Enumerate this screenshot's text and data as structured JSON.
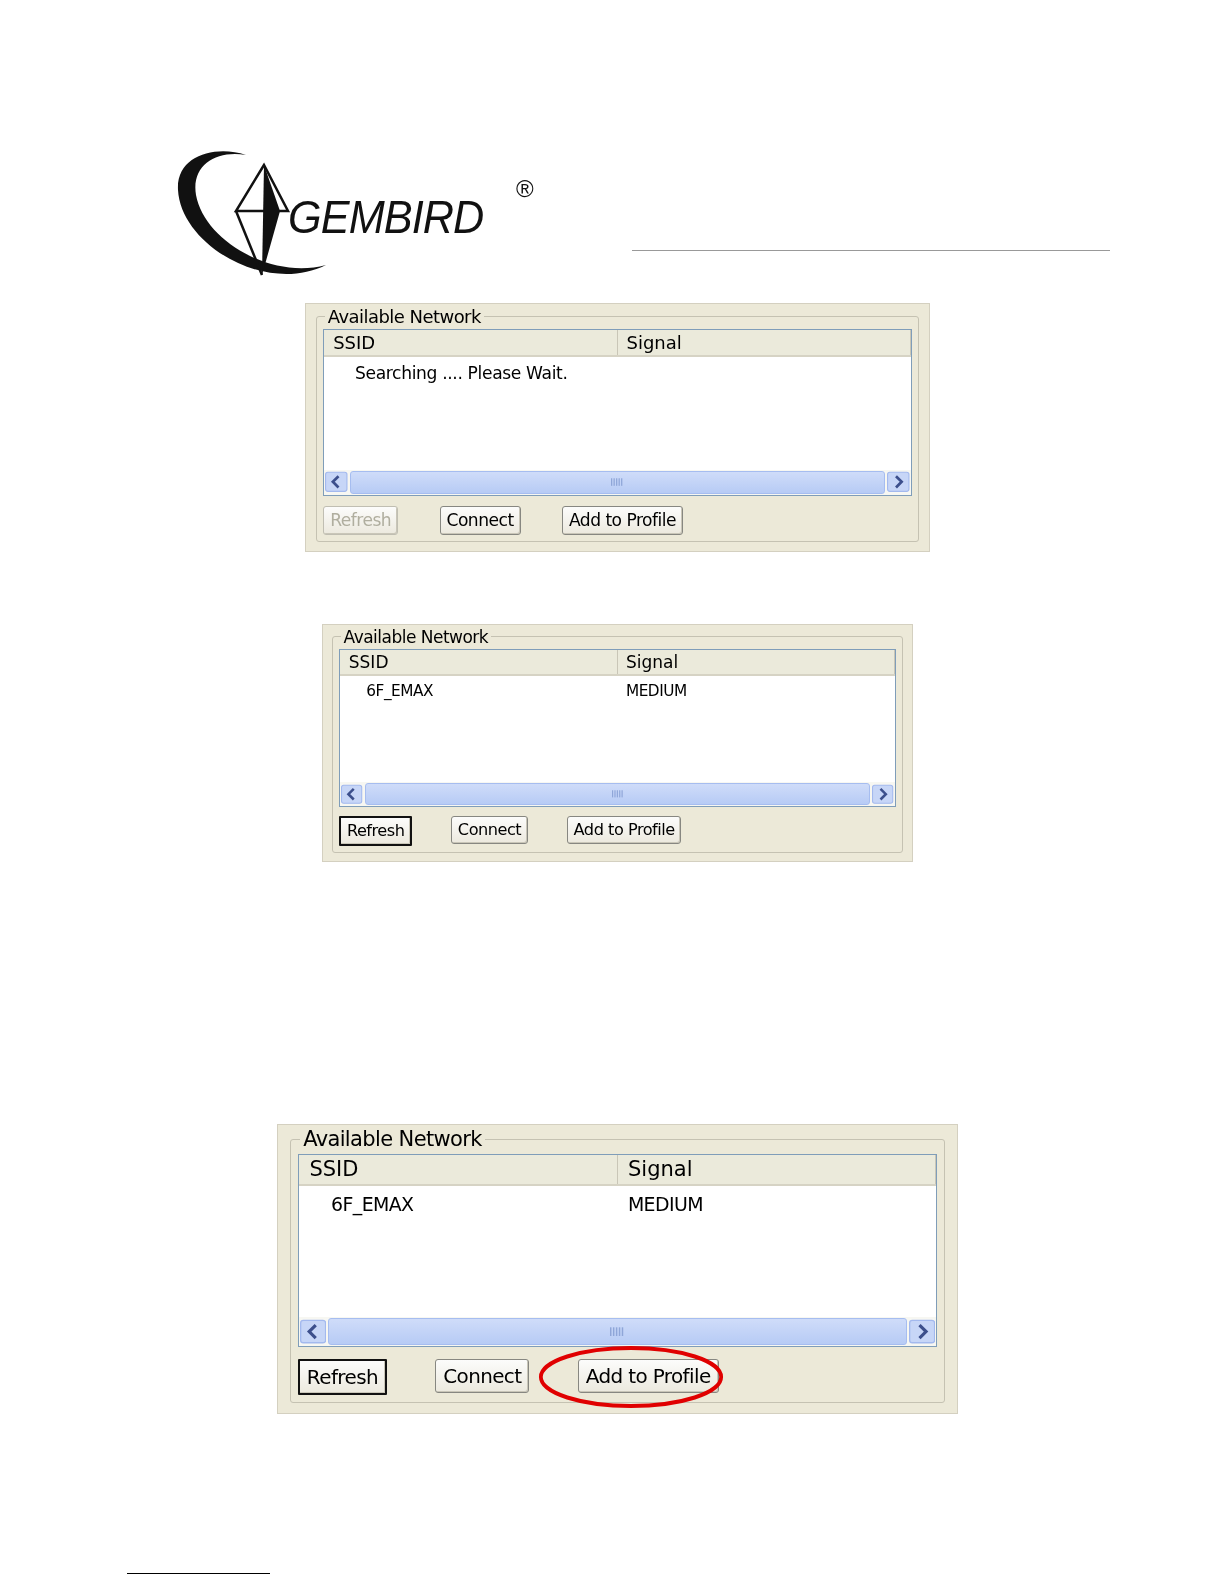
{
  "logo": {
    "brand": "GEMBIRD",
    "mark": "®"
  },
  "panels": [
    {
      "group_title": "Available Network",
      "columns": [
        "SSID",
        "Signal"
      ],
      "message": "Searching .... Please Wait.",
      "buttons": [
        {
          "label": "Refresh",
          "disabled": true,
          "default": false,
          "circled": false
        },
        {
          "label": "Connect",
          "disabled": false,
          "default": false,
          "circled": false
        },
        {
          "label": "Add to Profile",
          "disabled": false,
          "default": false,
          "circled": false
        }
      ]
    },
    {
      "group_title": "Available Network",
      "columns": [
        "SSID",
        "Signal"
      ],
      "rows": [
        [
          "6F_EMAX",
          "MEDIUM"
        ]
      ],
      "buttons": [
        {
          "label": "Refresh",
          "disabled": false,
          "default": true,
          "circled": false
        },
        {
          "label": "Connect",
          "disabled": false,
          "default": false,
          "circled": false
        },
        {
          "label": "Add to Profile",
          "disabled": false,
          "default": false,
          "circled": false
        }
      ]
    },
    {
      "group_title": "Available Network",
      "columns": [
        "SSID",
        "Signal"
      ],
      "rows": [
        [
          "6F_EMAX",
          "MEDIUM"
        ]
      ],
      "buttons": [
        {
          "label": "Refresh",
          "disabled": false,
          "default": true,
          "circled": false
        },
        {
          "label": "Connect",
          "disabled": false,
          "default": false,
          "circled": false
        },
        {
          "label": "Add to Profile",
          "disabled": false,
          "default": false,
          "circled": true
        }
      ]
    }
  ]
}
